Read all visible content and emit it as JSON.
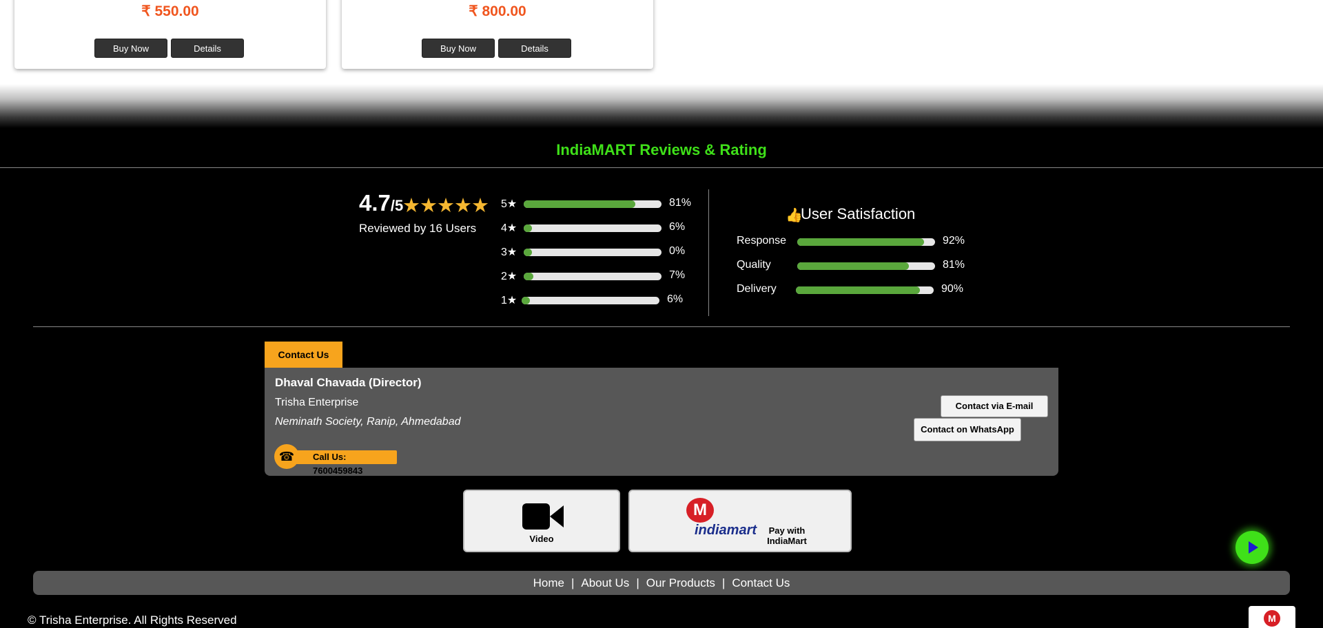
{
  "products": [
    {
      "price": "₹ 550.00",
      "buy_label": "Buy Now",
      "details_label": "Details"
    },
    {
      "price": "₹ 800.00",
      "buy_label": "Buy Now",
      "details_label": "Details"
    }
  ],
  "reviews": {
    "title": "IndiaMART Reviews & Rating",
    "score": "4.7",
    "score_of": "/5",
    "stars": "★★★★★",
    "reviewed_by": "Reviewed by 16 Users",
    "distribution": [
      {
        "label": "5★",
        "percent": 81,
        "percent_text": "81%"
      },
      {
        "label": "4★",
        "percent": 6,
        "percent_text": "6%"
      },
      {
        "label": "3★",
        "percent": 0,
        "percent_text": "0%"
      },
      {
        "label": "2★",
        "percent": 7,
        "percent_text": "7%"
      },
      {
        "label": "1★",
        "percent": 6,
        "percent_text": "6%"
      }
    ]
  },
  "satisfaction": {
    "title": "User Satisfaction",
    "metrics": [
      {
        "label": "Response",
        "percent": 92,
        "percent_text": "92%"
      },
      {
        "label": "Quality",
        "percent": 81,
        "percent_text": "81%"
      },
      {
        "label": "Delivery",
        "percent": 90,
        "percent_text": "90%"
      }
    ]
  },
  "contact": {
    "tab_label": "Contact Us",
    "name": "Dhaval Chavada (Director)",
    "company": "Trisha Enterprise",
    "address": "Neminath Society, Ranip, Ahmedabad",
    "call_label": "Call Us: 7600459843",
    "email_button": "Contact via E-mail",
    "whatsapp_button": "Contact on WhatsApp"
  },
  "tiles": {
    "video_label": "Video",
    "pay_brand": "indiamart",
    "pay_label": "Pay with IndiaMart"
  },
  "footer": {
    "nav": [
      "Home",
      "About Us",
      "Our Products",
      "Contact Us"
    ],
    "copyright": "© Trisha Enterprise. All Rights Reserved"
  },
  "colors": {
    "accent_orange": "#f7a41d",
    "price": "#f0561f",
    "title_green": "#3fe019",
    "bar_fill": "#5aa73c"
  }
}
